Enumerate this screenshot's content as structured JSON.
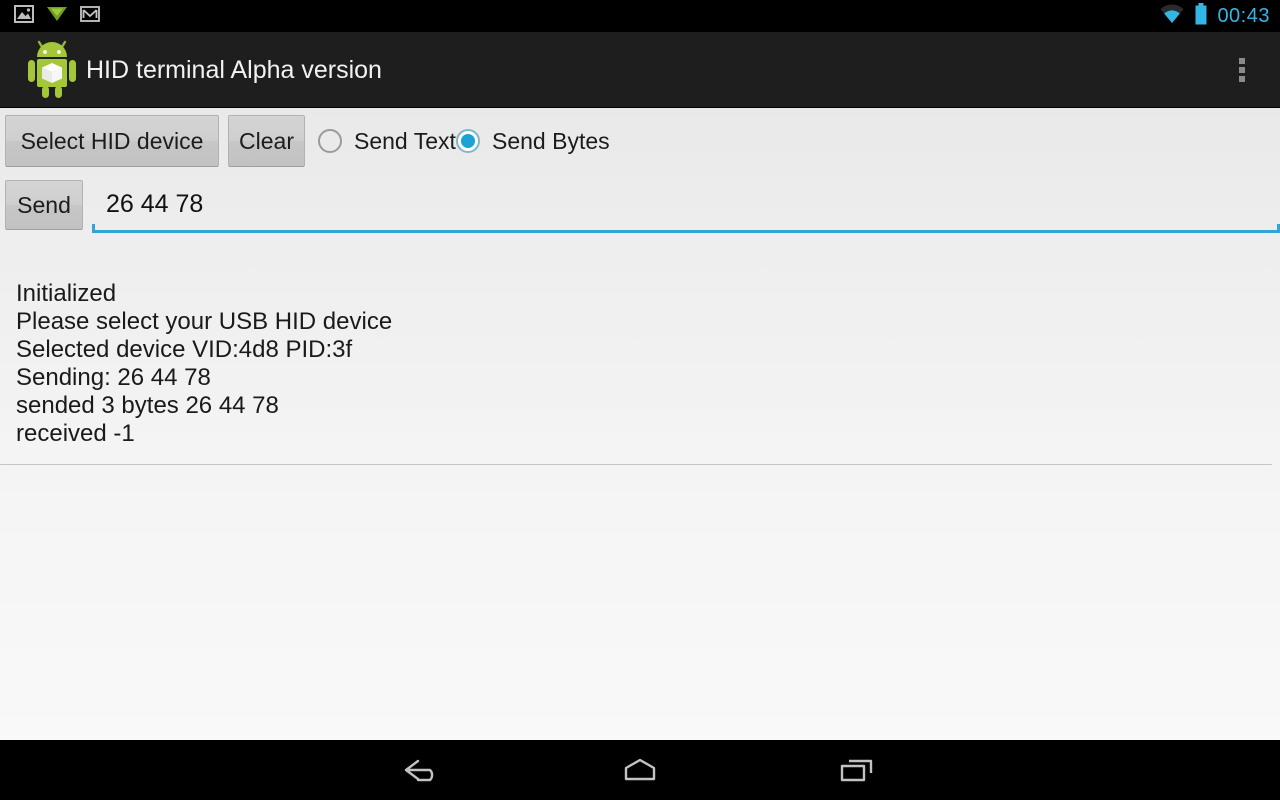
{
  "status_bar": {
    "icons": [
      "photo-icon",
      "download-icon",
      "gmail-icon"
    ],
    "wifi_icon": "wifi-icon",
    "battery_icon": "battery-icon",
    "clock": "00:43",
    "accent_color": "#33b5e5",
    "background_color": "#000000"
  },
  "action_bar": {
    "app_icon": "android-robot-icon",
    "title": "HID terminal Alpha version",
    "overflow_icon": "overflow-menu-icon",
    "background_color": "#1e1e1e",
    "title_color": "#f2f2f2"
  },
  "toolbar": {
    "select_device_label": "Select HID device",
    "clear_label": "Clear",
    "send_label": "Send",
    "radio_options": [
      {
        "label": "Send Text",
        "selected": false
      },
      {
        "label": "Send Bytes",
        "selected": true
      }
    ],
    "radio_selected_color": "#1ea1d4"
  },
  "input": {
    "value": "26 44 78",
    "placeholder": "",
    "underline_color": "#30a5d6"
  },
  "log": {
    "lines": [
      "Initialized",
      "Please select your USB HID device",
      "Selected device VID:4d8 PID:3f",
      "Sending: 26 44 78",
      "sended 3 bytes 26 44 78",
      "received -1"
    ]
  },
  "nav_bar": {
    "back_icon": "back-arrow-icon",
    "home_icon": "home-icon",
    "recents_icon": "recent-apps-icon",
    "background_color": "#000000"
  }
}
